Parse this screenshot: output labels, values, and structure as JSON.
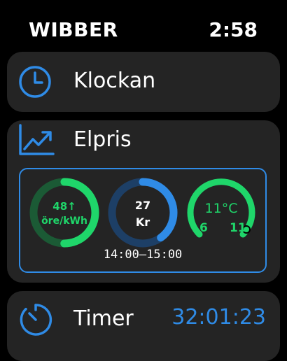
{
  "status_bar": {
    "app_name": "WIBBER",
    "time": "2:58"
  },
  "clock_card": {
    "title": "Klockan",
    "icon": "clock-icon"
  },
  "elpris_card": {
    "title": "Elpris",
    "icon": "trend-up-icon",
    "price_gauge": {
      "value": "48↑",
      "unit": "öre/kWh",
      "level": 0.5,
      "color": "#1fd66a"
    },
    "cost_gauge": {
      "value": "27",
      "unit": "Kr",
      "level": 0.4,
      "color": "#2f8be6"
    },
    "temp_gauge": {
      "value": "11°C",
      "low": "6",
      "high": "11",
      "level": 0.75,
      "color": "#1fd66a"
    },
    "hours": "14:00–15:00"
  },
  "timer_card": {
    "title": "Timer",
    "value": "32:01:23",
    "icon": "timer-icon"
  },
  "colors": {
    "accent_blue": "#2f8be6",
    "accent_green": "#1fd66a",
    "card_bg": "#242424"
  }
}
